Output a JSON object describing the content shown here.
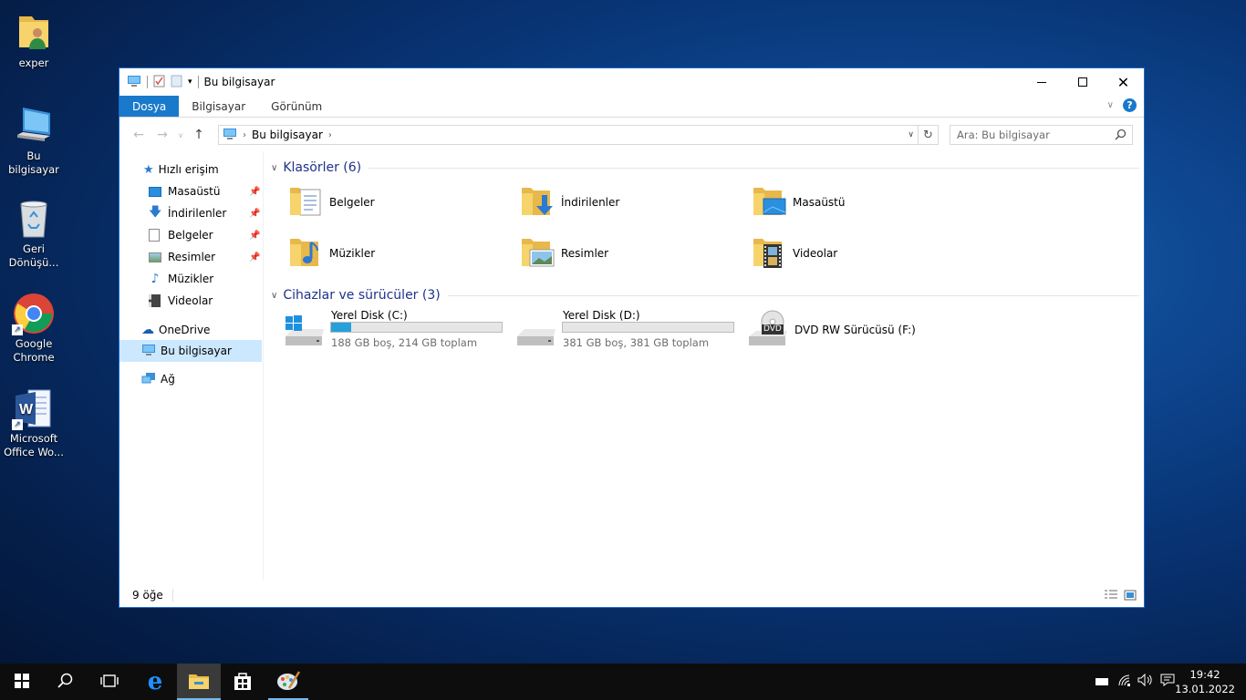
{
  "desktop": {
    "icons": [
      {
        "label": "exper"
      },
      {
        "label": "Bu bilgisayar"
      },
      {
        "label_line1": "Geri",
        "label_line2": "Dönüşü..."
      },
      {
        "label_line1": "Google",
        "label_line2": "Chrome"
      },
      {
        "label_line1": "Microsoft",
        "label_line2": "Office Wo..."
      }
    ]
  },
  "window": {
    "title": "Bu bilgisayar",
    "ribbon_tabs": [
      "Dosya",
      "Bilgisayar",
      "Görünüm"
    ],
    "help_glyph": "?",
    "address": {
      "path_item": "Bu bilgisayar"
    },
    "search": {
      "placeholder": "Ara: Bu bilgisayar"
    },
    "nav": {
      "quick_access": "Hızlı erişim",
      "pinned": [
        "Masaüstü",
        "İndirilenler",
        "Belgeler",
        "Resimler"
      ],
      "others": [
        "Müzikler",
        "Videolar"
      ],
      "onedrive": "OneDrive",
      "this_pc": "Bu bilgisayar",
      "network": "Ağ"
    },
    "folders_group": "Klasörler (6)",
    "folders": [
      "Belgeler",
      "İndirilenler",
      "Masaüstü",
      "Müzikler",
      "Resimler",
      "Videolar"
    ],
    "devices_group": "Cihazlar ve sürücüler (3)",
    "drives": [
      {
        "name": "Yerel Disk (C:)",
        "detail": "188 GB boş, 214 GB toplam",
        "used_fraction": 0.12
      },
      {
        "name": "Yerel Disk (D:)",
        "detail": "381 GB boş, 381 GB toplam",
        "used_fraction": 0.0
      },
      {
        "name": "DVD RW Sürücüsü (F:)",
        "badge": "DVD"
      }
    ],
    "status": "9 öğe"
  },
  "taskbar": {
    "time": "19:42",
    "date": "13.01.2022"
  },
  "colors": {
    "accent": "#1979ca",
    "selection": "#cce8ff",
    "drive_fill": "#26a0da",
    "group_header": "#1e3287"
  }
}
